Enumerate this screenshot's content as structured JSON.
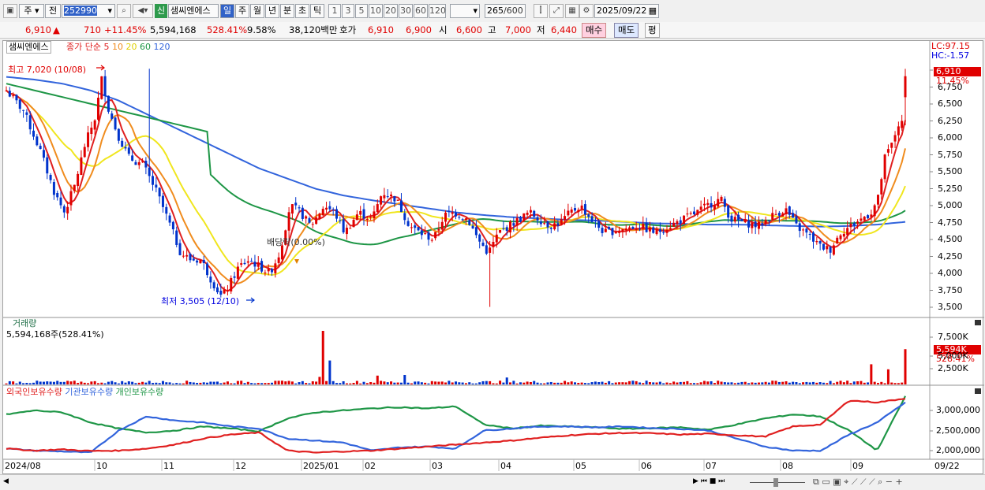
{
  "toolbar": {
    "market": "주",
    "prev_label": "전",
    "code": "252990",
    "stock_name": "샘씨엔에스",
    "new_badge": "신",
    "periods": [
      "일",
      "주",
      "월",
      "년",
      "분",
      "초",
      "틱"
    ],
    "numbers": [
      "1",
      "3",
      "5",
      "10",
      "20",
      "30",
      "60",
      "120"
    ],
    "count": "265",
    "total": "/600",
    "date": "2025/09/22"
  },
  "quote": {
    "price": "6,910",
    "change": "710",
    "change_pct": "+11.45%",
    "volume": "5,594,168",
    "volume_pct": "528.41%",
    "turnover": "9.58%",
    "amount": "38,120백만",
    "ask_label": "호가",
    "ask": "6,910",
    "bid": "6,900",
    "open_label": "시",
    "open": "6,600",
    "high_label": "고",
    "high": "7,000",
    "low_label": "저",
    "low": "6,440",
    "buy_label": "매수",
    "sell_label": "매도",
    "avg_label": "평"
  },
  "price_panel": {
    "name_tag": "샘씨엔에스",
    "ma_label": "종가 단순",
    "ma_periods": [
      "5",
      "10",
      "20",
      "60",
      "120"
    ],
    "lc": "LC:97.15",
    "hc": "HC:-1.57",
    "last_price": "6,910",
    "last_pct": "11.45%",
    "high_marker": "최고 7,020 (10/08)",
    "low_marker": "최저 3,505 (12/10)",
    "dividend": "배당락(0.00%)",
    "y_ticks": [
      "7,000",
      "6,750",
      "6,500",
      "6,250",
      "6,000",
      "5,750",
      "5,500",
      "5,250",
      "5,000",
      "4,750",
      "4,500",
      "4,250",
      "4,000",
      "3,750",
      "3,500"
    ]
  },
  "volume_panel": {
    "title": "거래량",
    "value": "5,594,168주(528.41%)",
    "y_ticks": [
      "7,500K",
      "5,000K",
      "2,500K"
    ],
    "last": "5,594K",
    "last_pct": "528.41%"
  },
  "holdings_panel": {
    "series": [
      "외국인보유수량",
      "기관보유수량",
      "개인보유수량"
    ],
    "y_ticks": [
      "3,000,000",
      "2,500,000",
      "2,000,000"
    ]
  },
  "x_axis": [
    "2024/08",
    "10",
    "11",
    "12",
    "2025/01",
    "02",
    "03",
    "04",
    "05",
    "06",
    "07",
    "08",
    "09",
    "09/22"
  ],
  "colors": {
    "ma5": "#e02020",
    "ma10": "#f08c1e",
    "ma20": "#f0e61e",
    "ma60": "#1e9646",
    "ma120": "#3264dc",
    "up": "#e00000",
    "down": "#0033cc"
  }
}
